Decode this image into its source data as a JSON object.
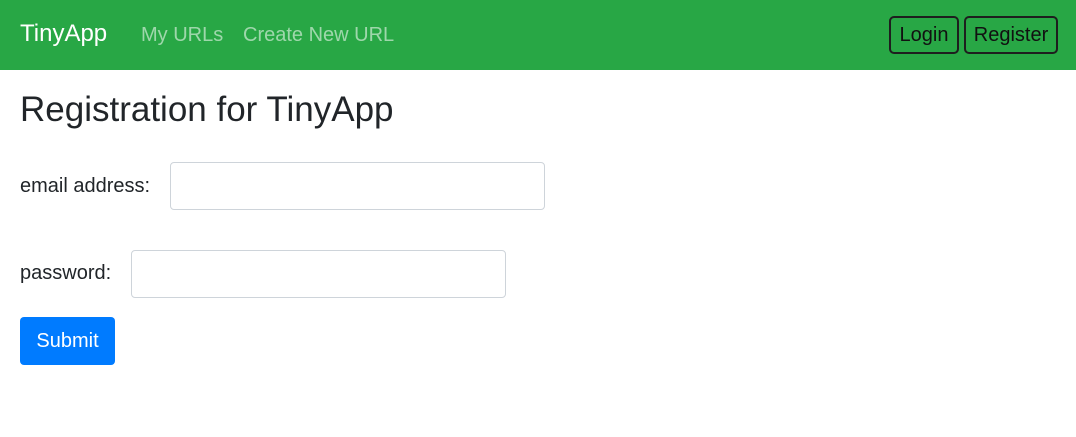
{
  "navbar": {
    "brand": "TinyApp",
    "links": [
      {
        "label": "My URLs"
      },
      {
        "label": "Create New URL"
      }
    ],
    "login_label": "Login",
    "register_label": "Register",
    "background_color": "#28a745"
  },
  "main": {
    "title": "Registration for TinyApp",
    "form": {
      "email_label": "email address:",
      "email_value": "",
      "password_label": "password:",
      "password_value": "",
      "submit_label": "Submit",
      "submit_color": "#007bff"
    }
  }
}
